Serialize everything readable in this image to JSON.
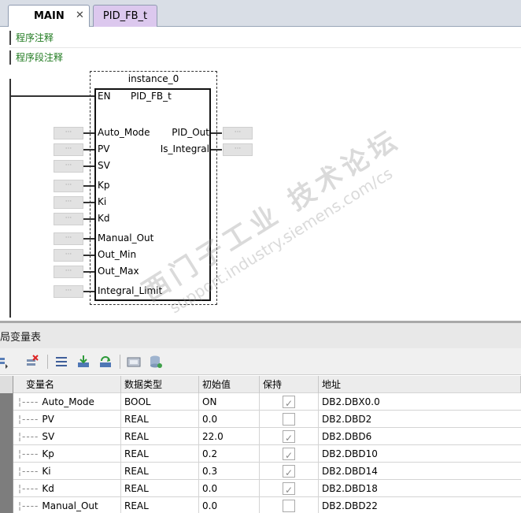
{
  "tabs": [
    {
      "label": "MAIN",
      "close": "✕"
    },
    {
      "label": "PID_FB_t"
    }
  ],
  "editor": {
    "program_comment": "程序注释",
    "segment_comment": "程序段注释",
    "instance_name": "instance_0",
    "block_name": "PID_FB_t",
    "en_label": "EN",
    "param_placeholder": "···",
    "inputs": [
      "Auto_Mode",
      "PV",
      "SV",
      "Kp",
      "Ki",
      "Kd",
      "Manual_Out",
      "Out_Min",
      "Out_Max",
      "Integral_Limit"
    ],
    "outputs": [
      "PID_Out",
      "Is_Integral"
    ]
  },
  "panel": {
    "title": "局变量表",
    "toolbar_icons": [
      "insert-row-icon",
      "delete-row-icon",
      "list-icon",
      "import-icon",
      "refresh-icon",
      "monitor-icon",
      "database-icon"
    ]
  },
  "table": {
    "headers": [
      "变量名",
      "数据类型",
      "初始值",
      "保持",
      "地址"
    ],
    "rows": [
      {
        "name": "Auto_Mode",
        "type": "BOOL",
        "init": "ON",
        "keep": true,
        "addr": "DB2.DBX0.0"
      },
      {
        "name": "PV",
        "type": "REAL",
        "init": "0.0",
        "keep": false,
        "addr": "DB2.DBD2"
      },
      {
        "name": "SV",
        "type": "REAL",
        "init": "22.0",
        "keep": true,
        "addr": "DB2.DBD6"
      },
      {
        "name": "Kp",
        "type": "REAL",
        "init": "0.2",
        "keep": true,
        "addr": "DB2.DBD10"
      },
      {
        "name": "Ki",
        "type": "REAL",
        "init": "0.3",
        "keep": true,
        "addr": "DB2.DBD14"
      },
      {
        "name": "Kd",
        "type": "REAL",
        "init": "0.0",
        "keep": true,
        "addr": "DB2.DBD18"
      },
      {
        "name": "Manual_Out",
        "type": "REAL",
        "init": "0.0",
        "keep": false,
        "addr": "DB2.DBD22"
      }
    ]
  },
  "watermark": {
    "line1": "西门子工业 技术论坛",
    "line2": "support.industry.siemens.com/cs"
  },
  "colors": {
    "comment_green": "#1f7a1f",
    "fb_tab_purple": "#dcc8ee",
    "row_header_gray": "#7d7d7d"
  }
}
